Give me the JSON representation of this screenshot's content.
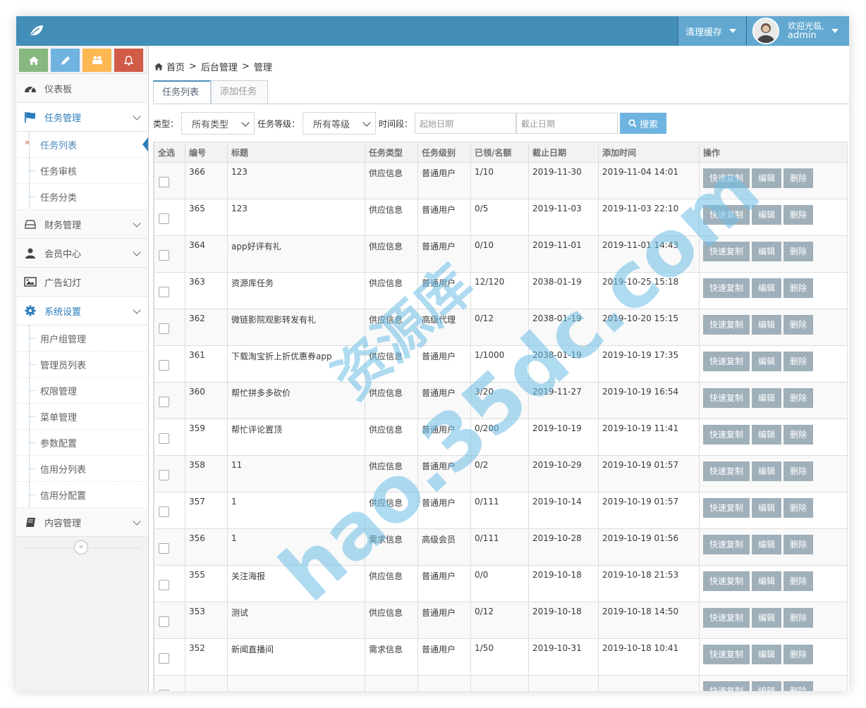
{
  "header": {
    "clear_cache": "清理缓存",
    "welcome": "欢迎光临,",
    "username": "admin"
  },
  "sidebar": {
    "shortcuts": [
      "home-icon",
      "pencil-icon",
      "users-icon",
      "bell-icon"
    ],
    "items": [
      {
        "label": "仪表板",
        "icon": "dashboard-icon"
      },
      {
        "label": "任务管理",
        "icon": "flag-icon",
        "open": true,
        "children": [
          "任务列表",
          "任务审核",
          "任务分类"
        ]
      },
      {
        "label": "财务管理",
        "icon": "hdd-icon"
      },
      {
        "label": "会员中心",
        "icon": "user-icon"
      },
      {
        "label": "广告幻灯",
        "icon": "picture-icon"
      },
      {
        "label": "系统设置",
        "icon": "cog-icon",
        "open": true,
        "children": [
          "用户组管理",
          "管理员列表",
          "权限管理",
          "菜单管理",
          "参数配置",
          "信用分列表",
          "信用分配置"
        ]
      },
      {
        "label": "内容管理",
        "icon": "book-icon"
      }
    ]
  },
  "breadcrumb": {
    "home": "首页",
    "sep": ">",
    "level2": "后台管理",
    "level3": "管理"
  },
  "tabs": {
    "list": "任务列表",
    "add": "添加任务"
  },
  "filters": {
    "type_label": "类型：",
    "type_value": "所有类型",
    "level_label": "任务等级：",
    "level_value": "所有等级",
    "period_label": "时间段：",
    "start_placeholder": "起始日期",
    "end_placeholder": "截止日期",
    "search": "搜索"
  },
  "table": {
    "columns": [
      "全选",
      "编号",
      "标题",
      "任务类型",
      "任务级别",
      "已领/名额",
      "截止日期",
      "添加时间",
      "操作"
    ],
    "actions": [
      "快速复制",
      "编辑",
      "删除"
    ],
    "rows": [
      [
        "366",
        "123",
        "供应信息",
        "普通用户",
        "1/10",
        "2019-11-30",
        "2019-11-04 14:01"
      ],
      [
        "365",
        "123",
        "供应信息",
        "普通用户",
        "0/5",
        "2019-11-03",
        "2019-11-03 22:10"
      ],
      [
        "364",
        "app好评有礼",
        "供应信息",
        "普通用户",
        "0/10",
        "2019-11-01",
        "2019-11-01 14:43"
      ],
      [
        "363",
        "资源库任务",
        "供应信息",
        "普通用户",
        "12/120",
        "2038-01-19",
        "2019-10-25 15:18"
      ],
      [
        "362",
        "微链影院观影转发有礼",
        "供应信息",
        "高级代理",
        "0/12",
        "2038-01-19",
        "2019-10-20 15:15"
      ],
      [
        "361",
        "下载淘宝折上折优惠券app",
        "供应信息",
        "普通用户",
        "1/1000",
        "2038-01-19",
        "2019-10-19 17:35"
      ],
      [
        "360",
        "帮忙拼多多砍价",
        "供应信息",
        "普通用户",
        "3/20",
        "2019-11-27",
        "2019-10-19 16:54"
      ],
      [
        "359",
        "帮忙评论置顶",
        "供应信息",
        "普通用户",
        "0/200",
        "2019-10-19",
        "2019-10-19 11:41"
      ],
      [
        "358",
        "11",
        "供应信息",
        "普通用户",
        "0/2",
        "2019-10-29",
        "2019-10-19 01:57"
      ],
      [
        "357",
        "1",
        "供应信息",
        "普通用户",
        "0/111",
        "2019-10-14",
        "2019-10-19 01:57"
      ],
      [
        "356",
        "1",
        "需求信息",
        "高级会员",
        "0/111",
        "2019-10-28",
        "2019-10-19 01:56"
      ],
      [
        "355",
        "关注海报",
        "供应信息",
        "普通用户",
        "0/0",
        "2019-10-18",
        "2019-10-18 21:53"
      ],
      [
        "353",
        "测试",
        "供应信息",
        "普通用户",
        "0/12",
        "2019-10-18",
        "2019-10-18 14:50"
      ],
      [
        "352",
        "新闻直播间",
        "需求信息",
        "普通用户",
        "1/50",
        "2019-10-31",
        "2019-10-18 10:41"
      ],
      [
        "",
        "",
        "",
        "",
        "",
        "",
        ""
      ]
    ]
  },
  "watermark": {
    "line1": "资源库",
    "line2": "hao.35dc.com"
  }
}
